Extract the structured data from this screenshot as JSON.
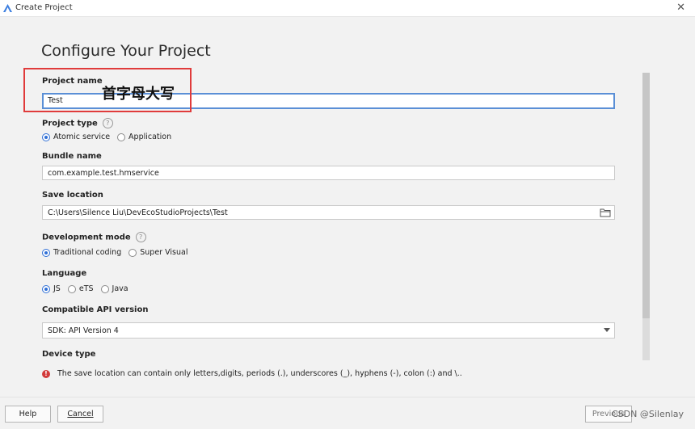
{
  "window": {
    "title": "Create Project",
    "close_symbol": "✕"
  },
  "page": {
    "heading": "Configure Your Project"
  },
  "project_name": {
    "label": "Project name",
    "value": "Test"
  },
  "project_type": {
    "label": "Project type",
    "help_symbol": "?",
    "options": [
      {
        "label": "Atomic service",
        "selected": true
      },
      {
        "label": "Application",
        "selected": false
      }
    ]
  },
  "bundle_name": {
    "label": "Bundle name",
    "value": "com.example.test.hmservice"
  },
  "save_location": {
    "label": "Save location",
    "value": "C:\\Users\\Silence Liu\\DevEcoStudioProjects\\Test"
  },
  "development_mode": {
    "label": "Development mode",
    "help_symbol": "?",
    "options": [
      {
        "label": "Traditional coding",
        "selected": true
      },
      {
        "label": "Super Visual",
        "selected": false
      }
    ]
  },
  "language": {
    "label": "Language",
    "options": [
      {
        "label": "JS",
        "selected": true
      },
      {
        "label": "eTS",
        "selected": false
      },
      {
        "label": "Java",
        "selected": false
      }
    ]
  },
  "compatible_api": {
    "label": "Compatible API version",
    "value": "SDK: API Version 4"
  },
  "device_type": {
    "label": "Device type"
  },
  "error": {
    "symbol": "!",
    "message": "The save location can contain only letters,digits, periods (.), underscores (_), hyphens (-), colon (:) and \\.."
  },
  "annotation": {
    "text": "首字母大写",
    "color": "#e03b3b"
  },
  "footer": {
    "help_label": "Help",
    "cancel_label": "Cancel",
    "previous_label": "Previous",
    "watermark": "CSDN @Silenlay"
  },
  "colors": {
    "accent": "#2f6fd6",
    "error": "#d23b3b"
  }
}
